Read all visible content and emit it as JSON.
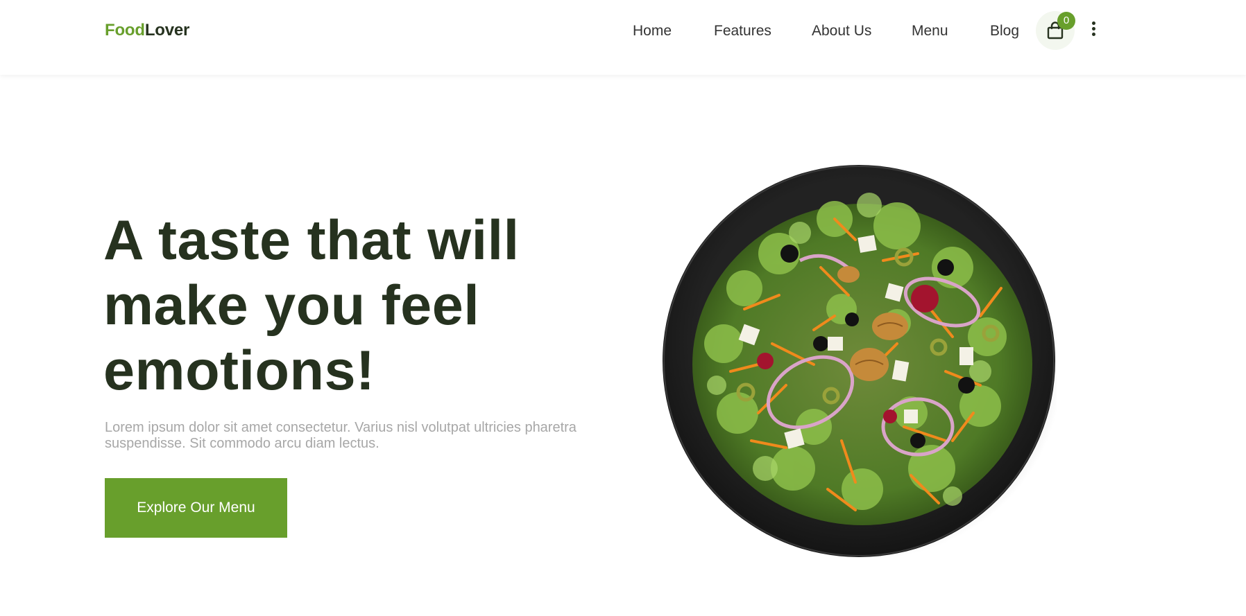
{
  "brand": {
    "part1": "Food",
    "part2": "Lover"
  },
  "nav": {
    "items": [
      {
        "label": "Home"
      },
      {
        "label": "Features"
      },
      {
        "label": "About Us"
      },
      {
        "label": "Menu"
      },
      {
        "label": "Blog"
      }
    ]
  },
  "cart": {
    "icon": "shopping-bag-icon",
    "count": "0"
  },
  "more_menu": {
    "icon": "more-vertical-icon"
  },
  "hero": {
    "title_lines": [
      "A taste that will",
      "make you feel",
      "emotions!"
    ],
    "subtitle_lines": [
      "Lorem ipsum dolor sit amet consectetur. Varius nisl volutpat ultricies pharetra",
      "suspendisse. Sit commodo arcu diam lectus."
    ],
    "cta_label": "Explore Our Menu"
  },
  "colors": {
    "accent": "#689f2c",
    "heading": "#26321f",
    "muted_text": "#a7a7a7",
    "plate": "#1e1e1e"
  }
}
